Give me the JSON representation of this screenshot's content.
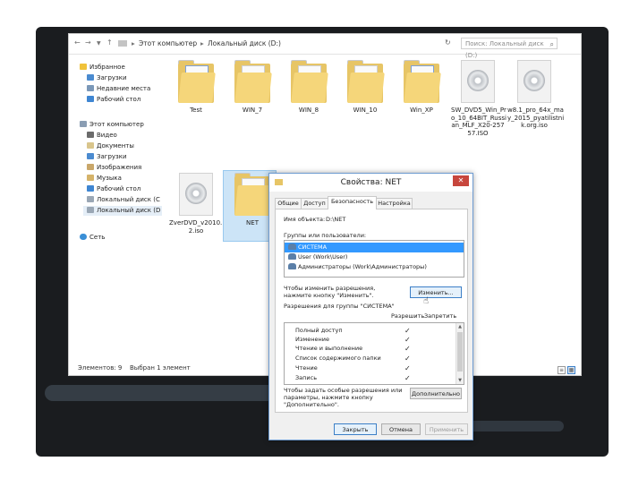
{
  "explorer": {
    "breadcrumb": [
      "Этот компьютер",
      "Локальный диск (D:)"
    ],
    "search_placeholder": "Поиск: Локальный диск (D:)",
    "nav": {
      "favorites": "Избранное",
      "favorites_items": [
        "Загрузки",
        "Недавние места",
        "Рабочий стол"
      ],
      "this_pc": "Этот компьютер",
      "this_pc_items": [
        "Видео",
        "Документы",
        "Загрузки",
        "Изображения",
        "Музыка",
        "Рабочий стол",
        "Локальный диск (C",
        "Локальный диск (D"
      ],
      "network": "Сеть"
    },
    "files": [
      {
        "name": "Test",
        "type": "folder"
      },
      {
        "name": "WIN_7",
        "type": "folder"
      },
      {
        "name": "WIN_8",
        "type": "folder"
      },
      {
        "name": "WIN_10",
        "type": "folder"
      },
      {
        "name": "Win_XP",
        "type": "folder"
      },
      {
        "name": "SW_DVD5_Win_Pro_10_64BIT_Russian_MLF_X20-25757.ISO",
        "lines": [
          "SW_DVD5_Win_Pr",
          "o_10_64BIT_Russi",
          "an_MLF_X20-257",
          "57.ISO"
        ],
        "type": "disc"
      },
      {
        "name": "w8.1_pro_64x_may_2015_pyatilistnik.org.iso",
        "lines": [
          "w8.1_pro_64x_ma",
          "y_2015_pyatilistni",
          "k.org.iso"
        ],
        "type": "disc"
      },
      {
        "name": "ZverDVD_v2010.12.iso",
        "lines": [
          "ZverDVD_v2010.1",
          "2.iso"
        ],
        "type": "disc"
      },
      {
        "name": "NET",
        "type": "folder"
      }
    ],
    "status": {
      "count": "Элементов: 9",
      "selected": "Выбран 1 элемент"
    }
  },
  "dialog": {
    "title": "Свойства: NET",
    "close": "✕",
    "tabs": [
      "Общие",
      "Доступ",
      "Безопасность",
      "Настройка"
    ],
    "object_label": "Имя объекта:",
    "object_value": "D:\\NET",
    "groups_label": "Группы или пользователи:",
    "users": [
      "СИСТЕМА",
      "User (Work\\User)",
      "Администраторы (Work\\Администраторы)"
    ],
    "change_hint": [
      "Чтобы изменить разрешения,",
      "нажмите кнопку \"Изменить\"."
    ],
    "change_button": "Изменить...",
    "permissions_for": "Разрешения для группы \"СИСТЕМА\"",
    "allow_header": "Разрешить",
    "deny_header": "Запретить",
    "permissions": [
      "Полный доступ",
      "Изменение",
      "Чтение и выполнение",
      "Список содержимого папки",
      "Чтение",
      "Запись"
    ],
    "special_hint": [
      "Чтобы задать особые разрешения или",
      "параметры, нажмите кнопку",
      "\"Дополнительно\"."
    ],
    "advanced_button": "Дополнительно",
    "ok_button": "Закрыть",
    "cancel_button": "Отмена",
    "apply_button": "Применить"
  },
  "colors": {
    "accent": "#3399ff",
    "folder": "#e7c566",
    "close": "#c7463d"
  }
}
